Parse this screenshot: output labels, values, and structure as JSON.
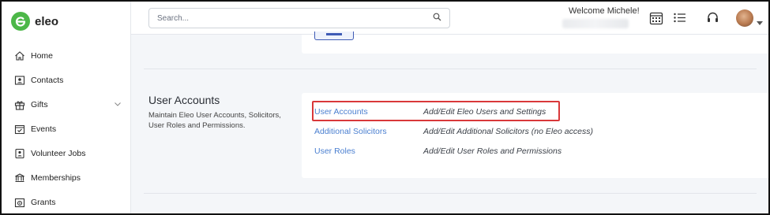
{
  "app": {
    "name": "eleo",
    "brand_color": "#4cb748",
    "link_color": "#4a7fd0",
    "highlight_color": "#d9383a"
  },
  "search": {
    "placeholder": "Search..."
  },
  "header": {
    "welcome": "Welcome Michele!"
  },
  "sidebar": {
    "items": [
      {
        "label": "Home",
        "icon": "home-icon"
      },
      {
        "label": "Contacts",
        "icon": "contacts-icon"
      },
      {
        "label": "Gifts",
        "icon": "gift-icon",
        "expandable": true
      },
      {
        "label": "Events",
        "icon": "calendar-check-icon"
      },
      {
        "label": "Volunteer Jobs",
        "icon": "volunteer-icon"
      },
      {
        "label": "Memberships",
        "icon": "badge-icon"
      },
      {
        "label": "Grants",
        "icon": "grants-icon"
      }
    ]
  },
  "section": {
    "title": "User Accounts",
    "description": "Maintain Eleo User Accounts, Solicitors, User Roles and Permissions.",
    "links": [
      {
        "label": "User Accounts",
        "description": "Add/Edit Eleo Users and Settings",
        "highlighted": true
      },
      {
        "label": "Additional Solicitors",
        "description": "Add/Edit Additional Solicitors (no Eleo access)"
      },
      {
        "label": "User Roles",
        "description": "Add/Edit User Roles and Permissions"
      }
    ]
  }
}
